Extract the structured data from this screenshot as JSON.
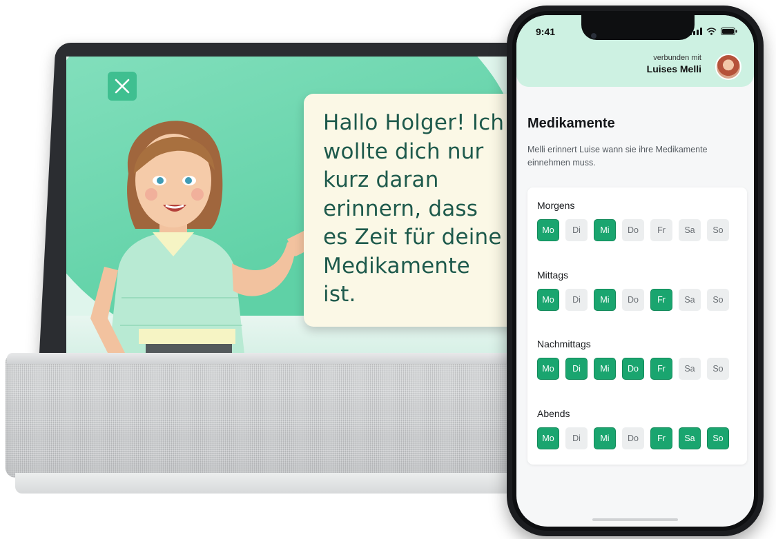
{
  "display": {
    "speech": "Hallo Holger! Ich\nwollte dich nur\nkurz daran\nerinnern, dass\nes Zeit für deine\nMedikamente\nist."
  },
  "phone": {
    "status_time": "9:41",
    "connected_label": "verbunden mit",
    "connected_name": "Luises Melli",
    "title": "Medikamente",
    "subtitle": "Melli erinnert Luise wann sie ihre Medikamente einnehmen muss.",
    "colors": {
      "accent": "#1aa56f",
      "header_bg": "#cdf1e2",
      "chip_off": "#eceeef"
    },
    "slots": [
      {
        "name": "Morgens",
        "days": [
          [
            "Mo",
            1
          ],
          [
            "Di",
            0
          ],
          [
            "Mi",
            1
          ],
          [
            "Do",
            0
          ],
          [
            "Fr",
            0
          ],
          [
            "Sa",
            0
          ],
          [
            "So",
            0
          ]
        ]
      },
      {
        "name": "Mittags",
        "days": [
          [
            "Mo",
            1
          ],
          [
            "Di",
            0
          ],
          [
            "Mi",
            1
          ],
          [
            "Do",
            0
          ],
          [
            "Fr",
            1
          ],
          [
            "Sa",
            0
          ],
          [
            "So",
            0
          ]
        ]
      },
      {
        "name": "Nachmittags",
        "days": [
          [
            "Mo",
            1
          ],
          [
            "Di",
            1
          ],
          [
            "Mi",
            1
          ],
          [
            "Do",
            1
          ],
          [
            "Fr",
            1
          ],
          [
            "Sa",
            0
          ],
          [
            "So",
            0
          ]
        ]
      },
      {
        "name": "Abends",
        "days": [
          [
            "Mo",
            1
          ],
          [
            "Di",
            0
          ],
          [
            "Mi",
            1
          ],
          [
            "Do",
            0
          ],
          [
            "Fr",
            1
          ],
          [
            "Sa",
            1
          ],
          [
            "So",
            1
          ]
        ]
      }
    ]
  }
}
